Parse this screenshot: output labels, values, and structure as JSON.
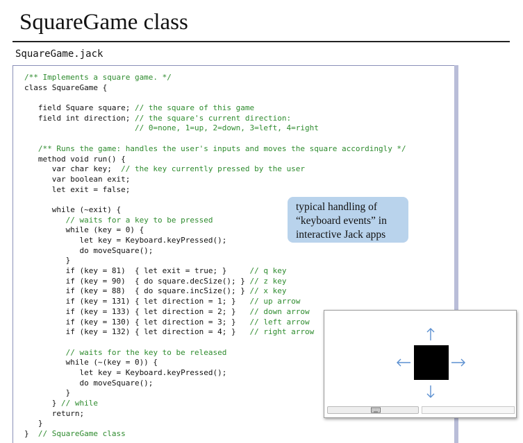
{
  "slide": {
    "title": "SquareGame class",
    "filename": "SquareGame.jack"
  },
  "code": {
    "lines": [
      [
        {
          "t": "/** Implements a square game. */",
          "c": "cm"
        }
      ],
      [
        {
          "t": "class SquareGame {"
        }
      ],
      [
        {
          "t": ""
        }
      ],
      [
        {
          "t": "   field Square square; "
        },
        {
          "t": "// the square of this game",
          "c": "cm"
        }
      ],
      [
        {
          "t": "   field int direction; "
        },
        {
          "t": "// the square's current direction:",
          "c": "cm"
        }
      ],
      [
        {
          "t": "                        "
        },
        {
          "t": "// 0=none, 1=up, 2=down, 3=left, 4=right",
          "c": "cm"
        }
      ],
      [
        {
          "t": ""
        }
      ],
      [
        {
          "t": "   "
        },
        {
          "t": "/** Runs the game: handles the user's inputs and moves the square accordingly */",
          "c": "cm"
        }
      ],
      [
        {
          "t": "   method void run() {"
        }
      ],
      [
        {
          "t": "      var char key;  "
        },
        {
          "t": "// the key currently pressed by the user",
          "c": "cm"
        }
      ],
      [
        {
          "t": "      var boolean exit;"
        }
      ],
      [
        {
          "t": "      let exit = false;"
        }
      ],
      [
        {
          "t": ""
        }
      ],
      [
        {
          "t": "      while (~exit) {"
        }
      ],
      [
        {
          "t": "         "
        },
        {
          "t": "// waits for a key to be pressed",
          "c": "cm"
        }
      ],
      [
        {
          "t": "         while (key = 0) {"
        }
      ],
      [
        {
          "t": "            let key = Keyboard.keyPressed();"
        }
      ],
      [
        {
          "t": "            do moveSquare();"
        }
      ],
      [
        {
          "t": "         }"
        }
      ],
      [
        {
          "t": "         if (key = 81)  { let exit = true; }     "
        },
        {
          "t": "// q key",
          "c": "cm"
        }
      ],
      [
        {
          "t": "         if (key = 90)  { do square.decSize(); } "
        },
        {
          "t": "// z key",
          "c": "cm"
        }
      ],
      [
        {
          "t": "         if (key = 88)  { do square.incSize(); } "
        },
        {
          "t": "// x key",
          "c": "cm"
        }
      ],
      [
        {
          "t": "         if (key = 131) { let direction = 1; }   "
        },
        {
          "t": "// up arrow",
          "c": "cm"
        }
      ],
      [
        {
          "t": "         if (key = 133) { let direction = 2; }   "
        },
        {
          "t": "// down arrow",
          "c": "cm"
        }
      ],
      [
        {
          "t": "         if (key = 130) { let direction = 3; }   "
        },
        {
          "t": "// left arrow",
          "c": "cm"
        }
      ],
      [
        {
          "t": "         if (key = 132) { let direction = 4; }   "
        },
        {
          "t": "// right arrow",
          "c": "cm"
        }
      ],
      [
        {
          "t": ""
        }
      ],
      [
        {
          "t": "         "
        },
        {
          "t": "// waits for the key to be released",
          "c": "cm"
        }
      ],
      [
        {
          "t": "         while (~(key = 0)) {"
        }
      ],
      [
        {
          "t": "            let key = Keyboard.keyPressed();"
        }
      ],
      [
        {
          "t": "            do moveSquare();"
        }
      ],
      [
        {
          "t": "         }"
        }
      ],
      [
        {
          "t": "      } "
        },
        {
          "t": "// while",
          "c": "cm"
        }
      ],
      [
        {
          "t": "      return;"
        }
      ],
      [
        {
          "t": "   }"
        }
      ],
      [
        {
          "t": "}  "
        },
        {
          "t": "// SquareGame class",
          "c": "cm"
        }
      ]
    ],
    "comment_color": "#2e8b2e"
  },
  "callout": {
    "lines": [
      "typical handling of",
      "“keyboard events” in",
      "interactive Jack apps"
    ],
    "color": "#b9d3ec"
  },
  "demo": {
    "icons": [
      "up-arrow-icon",
      "down-arrow-icon",
      "left-arrow-icon",
      "right-arrow-icon",
      "keyboard-icon"
    ],
    "square_color": "#000000",
    "arrow_color": "#5b8fd0"
  }
}
